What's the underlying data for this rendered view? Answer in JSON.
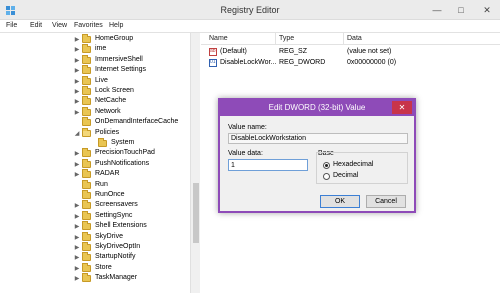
{
  "window": {
    "title": "Registry Editor",
    "min_glyph": "—",
    "max_glyph": "□",
    "close_glyph": "✕"
  },
  "menu": [
    "File",
    "Edit",
    "View",
    "Favorites",
    "Help"
  ],
  "tree": {
    "items": [
      {
        "label": "HomeGroup",
        "expander": "▶"
      },
      {
        "label": "ime",
        "expander": "▶"
      },
      {
        "label": "ImmersiveShell",
        "expander": "▶"
      },
      {
        "label": "Internet Settings",
        "expander": "▶"
      },
      {
        "label": "Live",
        "expander": "▶"
      },
      {
        "label": "Lock Screen",
        "expander": "▶"
      },
      {
        "label": "NetCache",
        "expander": "▶"
      },
      {
        "label": "Network",
        "expander": "▶"
      },
      {
        "label": "OnDemandInterfaceCache",
        "expander": ""
      },
      {
        "label": "Policies",
        "expander": "◢"
      },
      {
        "label": "System",
        "expander": "",
        "child": true
      },
      {
        "label": "PrecisionTouchPad",
        "expander": "▶"
      },
      {
        "label": "PushNotifications",
        "expander": "▶"
      },
      {
        "label": "RADAR",
        "expander": "▶"
      },
      {
        "label": "Run",
        "expander": ""
      },
      {
        "label": "RunOnce",
        "expander": ""
      },
      {
        "label": "Screensavers",
        "expander": "▶"
      },
      {
        "label": "SettingSync",
        "expander": "▶"
      },
      {
        "label": "Shell Extensions",
        "expander": "▶"
      },
      {
        "label": "SkyDrive",
        "expander": "▶"
      },
      {
        "label": "SkyDriveOptIn",
        "expander": "▶"
      },
      {
        "label": "StartupNotify",
        "expander": "▶"
      },
      {
        "label": "Store",
        "expander": "▶"
      },
      {
        "label": "TaskManager",
        "expander": "▶"
      }
    ]
  },
  "list": {
    "columns": [
      "Name",
      "Type",
      "Data"
    ],
    "rows": [
      {
        "name": "(Default)",
        "type": "REG_SZ",
        "data": "(value not set)",
        "icon": "string-value-icon"
      },
      {
        "name": "DisableLockWor...",
        "type": "REG_DWORD",
        "data": "0x00000000 (0)",
        "icon": "dword-value-icon"
      }
    ]
  },
  "dialog": {
    "title": "Edit DWORD (32-bit) Value",
    "close_glyph": "✕",
    "value_name_label": "Value name:",
    "value_name": "DisableLockWorkstation",
    "value_data_label": "Value data:",
    "value_data": "1",
    "base_label": "Base",
    "base_options": [
      "Hexadecimal",
      "Decimal"
    ],
    "base_selected": "Hexadecimal",
    "ok_label": "OK",
    "cancel_label": "Cancel",
    "accent": "#8e4bb8",
    "close_color": "#c8344a"
  }
}
